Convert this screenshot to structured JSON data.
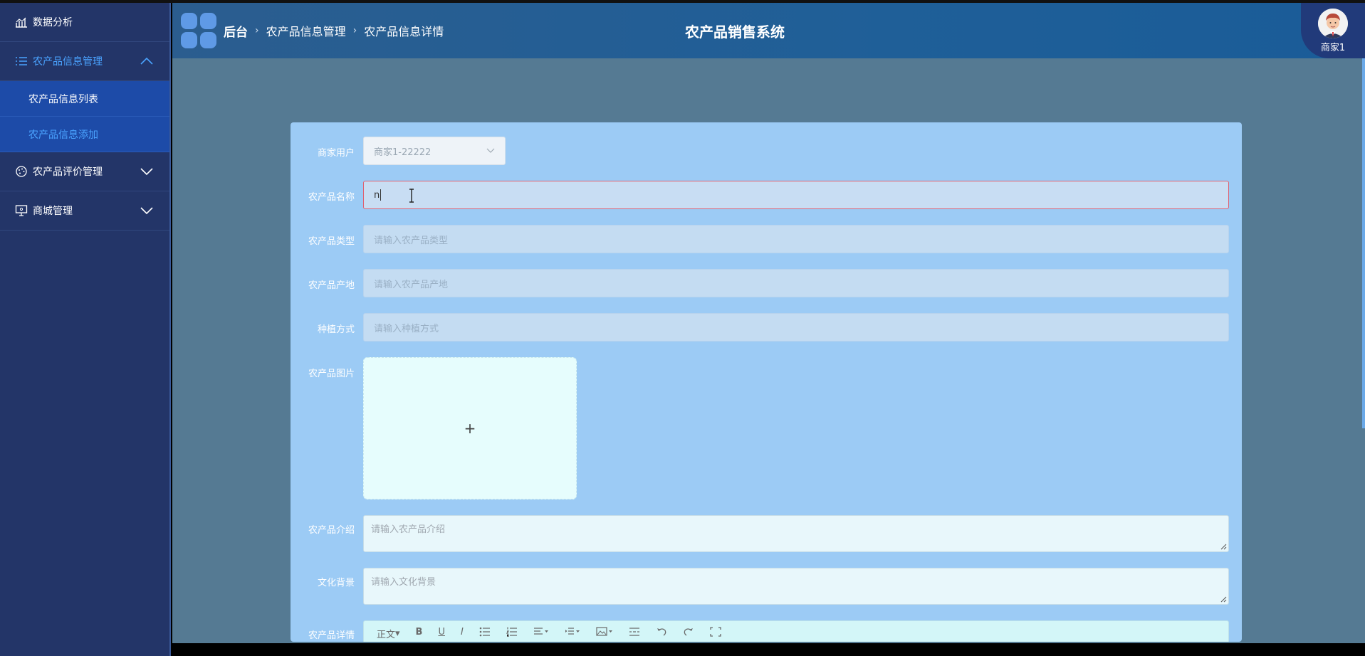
{
  "sidebar": {
    "items": [
      {
        "label": "数据分析",
        "icon": "chart-icon"
      },
      {
        "label": "农产品信息管理",
        "icon": "list-icon",
        "expanded": true,
        "children": [
          {
            "label": "农产品信息列表"
          },
          {
            "label": "农产品信息添加",
            "active": true
          }
        ]
      },
      {
        "label": "农产品评价管理",
        "icon": "palette-icon"
      },
      {
        "label": "商城管理",
        "icon": "monitor-icon"
      }
    ]
  },
  "header": {
    "breadcrumb": {
      "home": "后台",
      "level1": "农产品信息管理",
      "level2": "农产品信息详情"
    },
    "system_title": "农产品销售系统",
    "user_name": "商家1"
  },
  "form": {
    "merchant": {
      "label": "商家用户",
      "value": "商家1-22222"
    },
    "name": {
      "label": "农产品名称",
      "value": "n"
    },
    "type": {
      "label": "农产品类型",
      "placeholder": "请输入农产品类型"
    },
    "origin": {
      "label": "农产品产地",
      "placeholder": "请输入农产品产地"
    },
    "planting": {
      "label": "种植方式",
      "placeholder": "请输入种植方式"
    },
    "image": {
      "label": "农产品图片",
      "plus": "+"
    },
    "intro": {
      "label": "农产品介绍",
      "placeholder": "请输入农产品介绍"
    },
    "culture": {
      "label": "文化背景",
      "placeholder": "请输入文化背景"
    },
    "detail": {
      "label": "农产品详情",
      "toolbar_format": "正文"
    }
  },
  "colors": {
    "sidebar_bg": "#233568",
    "submenu_bg": "#1d4ba8",
    "active_text": "#4aa3ff",
    "header_bg": "#1f5f98",
    "card_bg": "#9ccbf5",
    "main_bg": "#557a93"
  }
}
